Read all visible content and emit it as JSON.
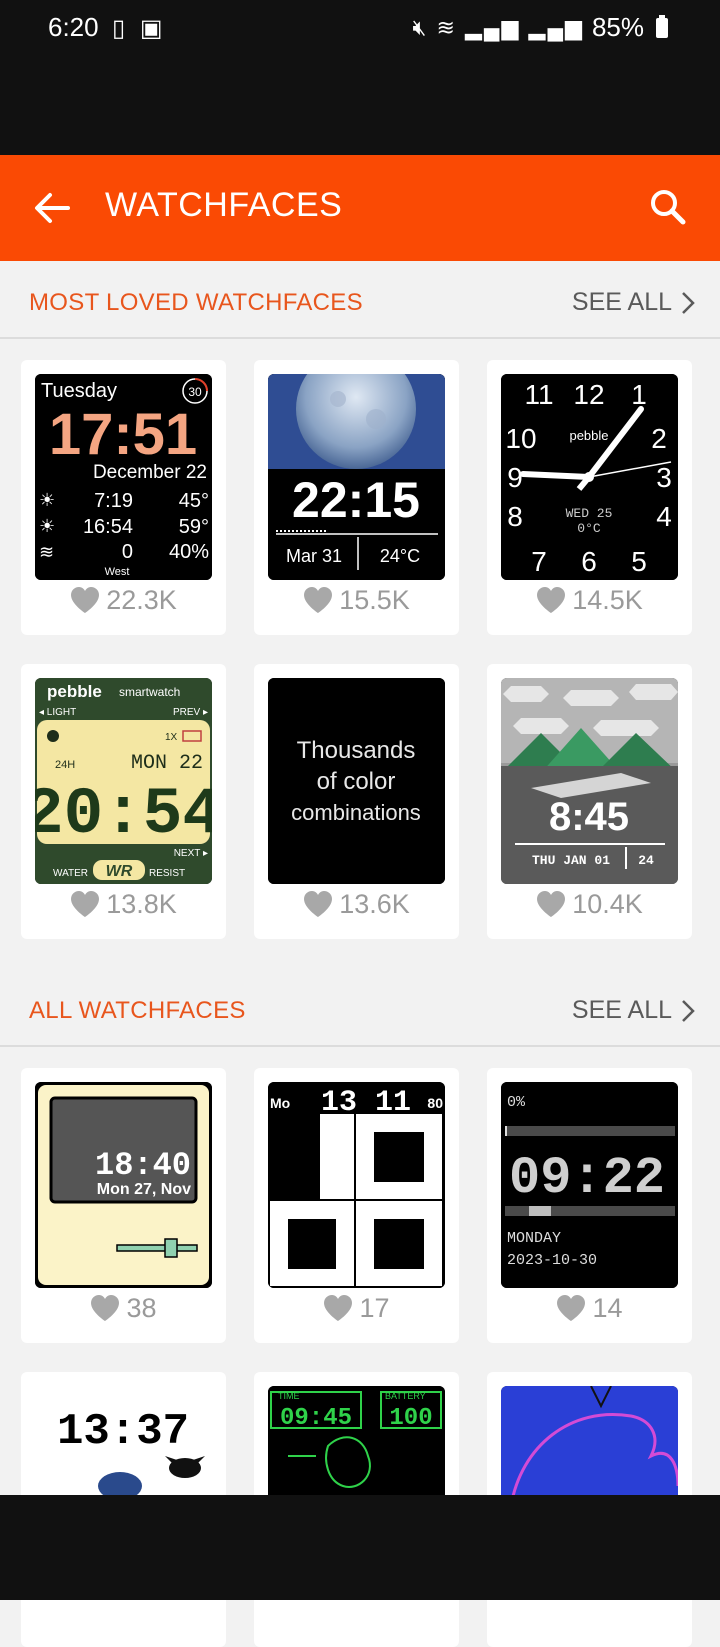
{
  "status_bar": {
    "time": "6:20",
    "battery": "85%"
  },
  "app_bar": {
    "title": "WATCHFACES",
    "back_icon": "arrow-left-icon",
    "search_icon": "search-icon"
  },
  "colors": {
    "accent": "#fa4a04",
    "section_title": "#e8561d",
    "like": "#9a9a9a"
  },
  "sections": [
    {
      "title": "MOST LOVED WATCHFACES",
      "see_all": "SEE ALL",
      "cards": [
        {
          "likes": "22.3K"
        },
        {
          "likes": "15.5K"
        },
        {
          "likes": "14.5K"
        },
        {
          "likes": "13.8K"
        },
        {
          "likes": "13.6K"
        },
        {
          "likes": "10.4K"
        }
      ]
    },
    {
      "title": "ALL WATCHFACES",
      "see_all": "SEE ALL",
      "cards": [
        {
          "likes": "38"
        },
        {
          "likes": "17"
        },
        {
          "likes": "14"
        },
        {
          "likes": ""
        },
        {
          "likes": ""
        },
        {
          "likes": ""
        }
      ]
    }
  ],
  "thumbs": {
    "t1": {
      "day": "Tuesday",
      "badge": "30",
      "time": "17:51",
      "date": "December 22",
      "sun1": "7:19",
      "temp1": "45°",
      "sun2": "16:54",
      "temp2": "59°",
      "wind": "0",
      "rain": "40%",
      "dir": "West"
    },
    "t2": {
      "time": "22:15",
      "date": "Mar 31",
      "temp": "24°C"
    },
    "t3": {
      "n11": "11",
      "n12": "12",
      "n1": "1",
      "n10": "10",
      "n2": "2",
      "n9": "9",
      "n3": "3",
      "n8": "8",
      "n4": "4",
      "n7": "7",
      "n6": "6",
      "n5": "5",
      "brand": "pebble",
      "day": "WED 25",
      "temp": "0°C"
    },
    "t4": {
      "brand": "pebble",
      "sub": "smartwatch",
      "light": "◂ LIGHT",
      "prev": "PREV ▸",
      "mode": "1X",
      "h24": "24H",
      "date": "MON 22",
      "time": "20:54",
      "next": "NEXT ▸",
      "water": "WATER",
      "wr": "WR",
      "resist": "RESIST"
    },
    "t5": {
      "line1": "Thousands",
      "line2": "of color",
      "line3": "combinations"
    },
    "t6": {
      "time": "8:45",
      "date": "THU JAN 01",
      "num": "24"
    },
    "t7": {
      "time": "18:40",
      "date": "Mon 27, Nov"
    },
    "t8": {
      "left": "Mo",
      "mid": "13 11",
      "right": "80"
    },
    "t9": {
      "pct": "0%",
      "time": "09:22",
      "day": "MONDAY",
      "date": "2023-10-30"
    },
    "t10": {
      "time": "13:37"
    },
    "t11": {
      "time_label": "TIME",
      "battery_label": "BATTERY",
      "time": "09:45",
      "battery": "100"
    }
  }
}
